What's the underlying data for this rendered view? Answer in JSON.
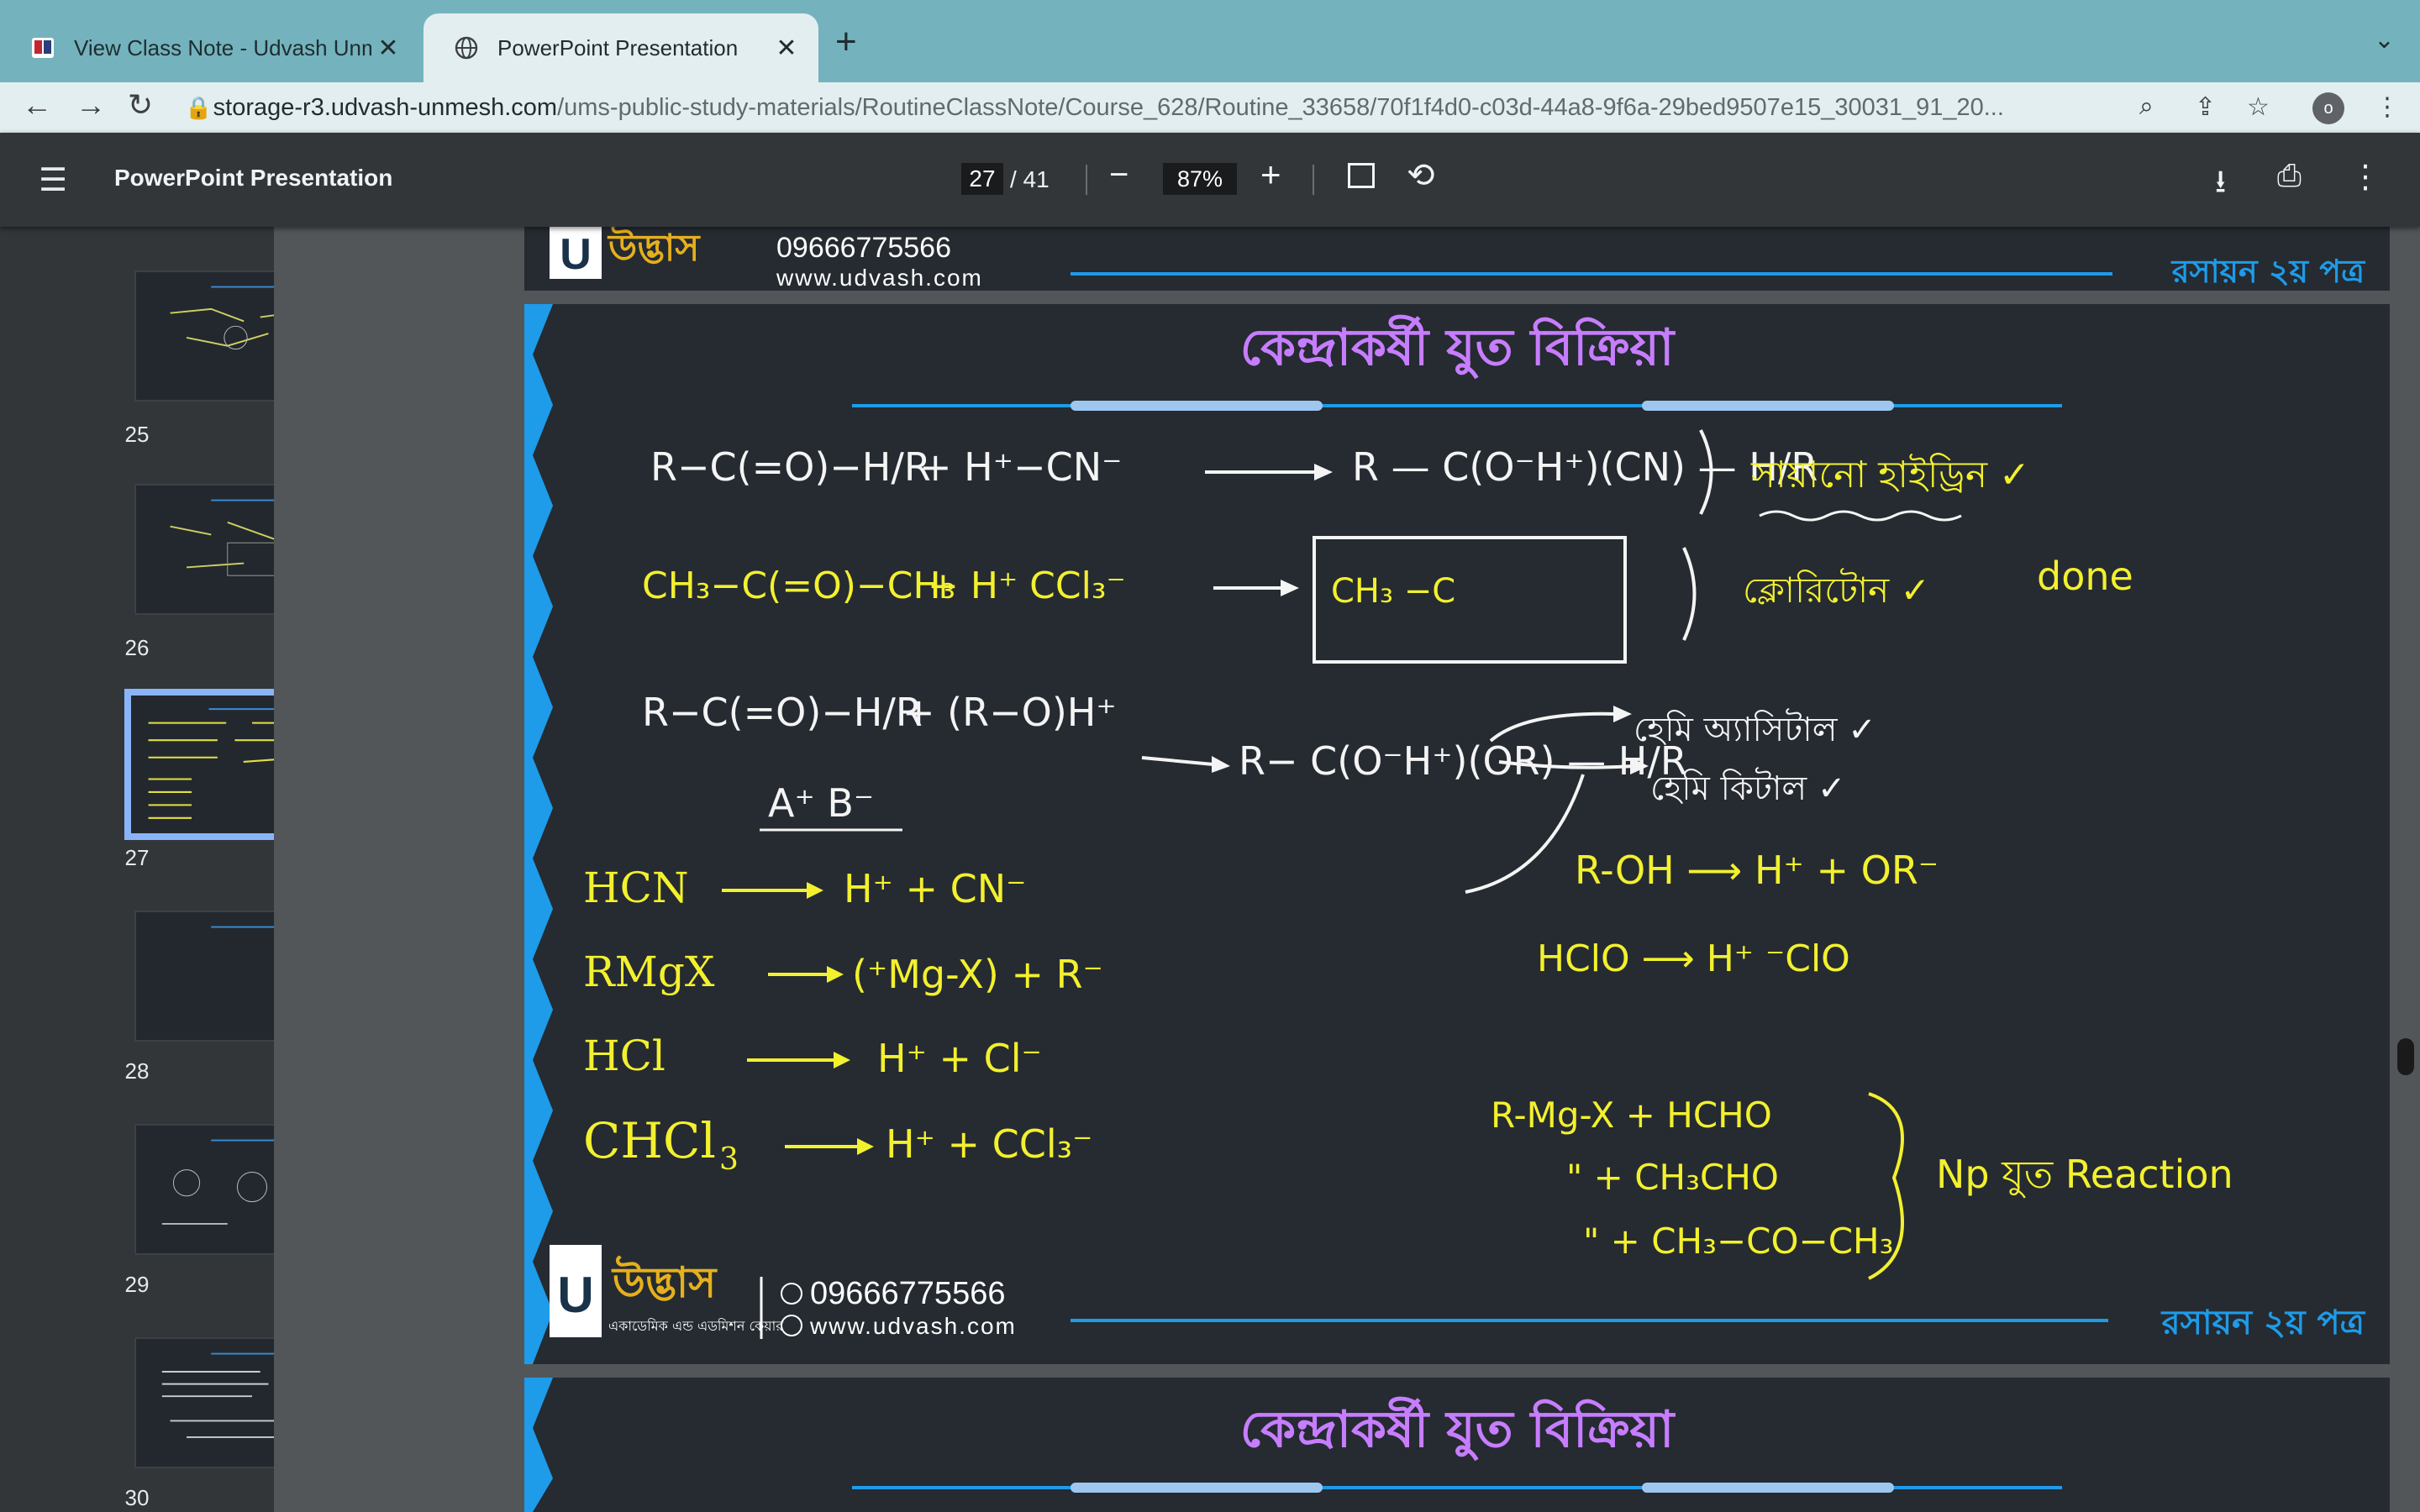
{
  "tabs": [
    {
      "title": "View Class Note - Udvash Unmesh",
      "active": false
    },
    {
      "title": "PowerPoint Presentation",
      "active": true
    }
  ],
  "toolbar": {
    "url_host": "storage-r3.udvash-unmesh.com",
    "url_path": "/ums-public-study-materials/RoutineClassNote/Course_628/Routine_33658/70f1f4d0-c03d-44a8-9f6a-29bed9507e15_30031_91_20...",
    "profile_initial": "o"
  },
  "pdf": {
    "title": "PowerPoint Presentation",
    "page_current": "27",
    "page_total": "/ 41",
    "zoom": "87%"
  },
  "thumbnails": [
    {
      "page": "25",
      "selected": false
    },
    {
      "page": "26",
      "selected": false
    },
    {
      "page": "27",
      "selected": true
    },
    {
      "page": "28",
      "selected": false
    },
    {
      "page": "29",
      "selected": false
    },
    {
      "page": "30",
      "selected": false
    }
  ],
  "slide": {
    "title": "কেন্দ্রাকর্ষী যুত বিক্রিয়া",
    "subject_badge": "রসায়ন ২য় পত্র",
    "phone": "09666775566",
    "website": "www.udvash.com",
    "brand": "উদ্ভাস",
    "brand_tagline": "একাডেমিক এন্ড এডমিশন কেয়ার",
    "logo_letter": "U",
    "printed_reagents": [
      "HCN",
      "RMgX",
      "HCl",
      "CHCl"
    ],
    "chcl_subscript": "3",
    "notes": {
      "r1_reactant": "R−C(=O)−H/R",
      "r1_reagent": "+  H⁺−CN⁻",
      "r1_product": "R — C(O⁻H⁺)(CN) — H/R",
      "r1_label": "সায়ানো হাইড্রিন ✓",
      "r2_reactant": "CH₃−C(=O)−CH₃",
      "r2_reagent": "+  H⁺  CCl₃⁻",
      "r2_box": "CH₃ −C",
      "r2_label": "ক্লোরিটোন ✓",
      "r2_done": "done",
      "r3_reactant": "R−C(=O)−H/R",
      "r3_reagent": "+  (R−O)H⁺",
      "r3_ab": "A⁺ B⁻",
      "r3_product": "R− C(O⁻H⁺)(OR) — H/R",
      "r3_label1": "হেমি অ্যাসিটাল ✓",
      "r3_label2": "হেমি কিটাল ✓",
      "roh": "R-OH  ⟶  H⁺ + OR⁻",
      "hclo": "HClO ⟶  H⁺  ⁻ClO",
      "hcn_products": "H⁺ + CN⁻",
      "rmgx_products": "(⁺Mg-X) + R⁻",
      "hcl_products": "H⁺ + Cl⁻",
      "chcl3_products": "H⁺ + CCl₃⁻",
      "grignard1": "R-Mg-X + HCHO",
      "grignard2": "\"  + CH₃CHO",
      "grignard3": "\"  + CH₃−CO−CH₃",
      "np_label": "Np যুত Reaction"
    }
  },
  "colors": {
    "tabstrip": "#74b3bd",
    "toolbar": "#e3eef0",
    "slide_bg": "#252b31",
    "title_purple": "#c77dff",
    "marker_yellow": "#f3f02e",
    "accent_blue": "#1e9be9"
  }
}
